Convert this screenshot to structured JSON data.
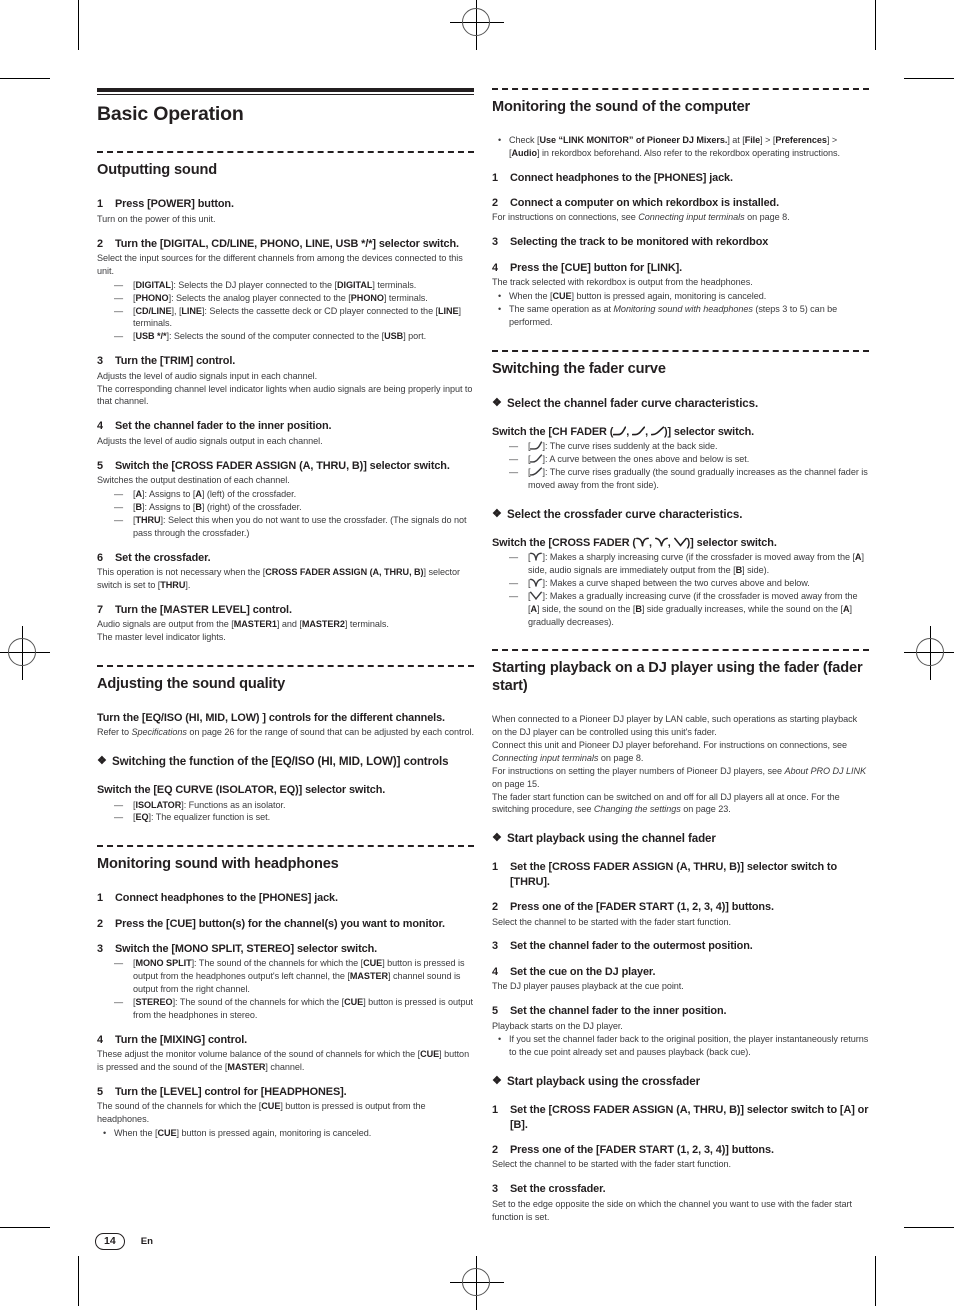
{
  "document": {
    "title": "Basic Operation",
    "footer": {
      "page_number": "14",
      "language": "En"
    }
  },
  "left_column": {
    "s1": {
      "heading": "Outputting sound",
      "step1": {
        "num": "1",
        "title": "Press [POWER] button.",
        "body": "Turn on the power of this unit."
      },
      "step2": {
        "num": "2",
        "title": "Turn the [DIGITAL, CD/LINE, PHONO, LINE, USB */*] selector switch.",
        "body": "Select the input sources for the different channels from among the devices connected to this unit.",
        "items": [
          "[DIGITAL]: Selects the DJ player connected to the [DIGITAL] terminals.",
          "[PHONO]: Selects the analog player connected to the [PHONO] terminals.",
          "[CD/LINE], [LINE]: Selects the cassette deck or CD player connected to the [LINE] terminals.",
          "[USB */*]: Selects the sound of the computer connected to the [USB] port."
        ]
      },
      "step3": {
        "num": "3",
        "title": "Turn the [TRIM] control.",
        "body1": "Adjusts the level of audio signals input in each channel.",
        "body2": "The corresponding channel level indicator lights when audio signals are being properly input to that channel."
      },
      "step4": {
        "num": "4",
        "title": "Set the channel fader to the inner position.",
        "body": "Adjusts the level of audio signals output in each channel."
      },
      "step5": {
        "num": "5",
        "title": "Switch the [CROSS FADER ASSIGN (A, THRU, B)] selector switch.",
        "body": "Switches the output destination of each channel.",
        "items": [
          "[A]: Assigns to [A] (left) of the crossfader.",
          "[B]: Assigns to [B] (right) of the crossfader.",
          "[THRU]: Select this when you do not want to use the crossfader. (The signals do not pass through the crossfader.)"
        ]
      },
      "step6": {
        "num": "6",
        "title": "Set the crossfader.",
        "body": "This operation is not necessary when the [CROSS FADER ASSIGN (A, THRU, B)] selector switch is set to [THRU]."
      },
      "step7": {
        "num": "7",
        "title": "Turn the [MASTER LEVEL] control.",
        "body1": "Audio signals are output from the [MASTER1] and [MASTER2] terminals.",
        "body2": "The master level indicator lights."
      }
    },
    "s2": {
      "heading": "Adjusting the sound quality",
      "lead_title": "Turn the [EQ/ISO (HI, MID, LOW) ] controls for the different channels.",
      "lead_body": "Refer to Specifications on page 26 for the range of sound that can be adjusted by each control.",
      "sub_heading": "Switching the function of the [EQ/ISO (HI, MID, LOW)] controls",
      "switch_title": "Switch the [EQ CURVE (ISOLATOR, EQ)] selector switch.",
      "items": [
        "[ISOLATOR]: Functions as an isolator.",
        "[EQ]: The equalizer function is set."
      ]
    },
    "s3": {
      "heading": "Monitoring sound with headphones",
      "step1": {
        "num": "1",
        "title": "Connect headphones to the [PHONES] jack."
      },
      "step2": {
        "num": "2",
        "title": "Press the [CUE] button(s) for the channel(s) you want to monitor."
      },
      "step3": {
        "num": "3",
        "title": "Switch the [MONO SPLIT, STEREO] selector switch.",
        "items": [
          "[MONO SPLIT]: The sound of the channels for which the [CUE] button is pressed is output from the headphones output's left channel, the [MASTER] channel sound is output from the right channel.",
          "[STEREO]: The sound of the channels for which the [CUE] button is pressed is output from the headphones in stereo."
        ]
      },
      "step4": {
        "num": "4",
        "title": "Turn the [MIXING] control.",
        "body": "These adjust the monitor volume balance of the sound of channels for which the [CUE] button is pressed and the sound of the [MASTER] channel."
      },
      "step5": {
        "num": "5",
        "title": "Turn the [LEVEL] control for [HEADPHONES].",
        "body": "The sound of the channels for which the [CUE] button is pressed is output from the headphones.",
        "note": "When the [CUE] button is pressed again, monitoring is canceled."
      }
    }
  },
  "right_column": {
    "s1": {
      "heading": "Monitoring the sound of the computer",
      "note": "Check [Use “LINK MONITOR” of Pioneer DJ Mixers.] at [File] > [Preferences] > [Audio] in rekordbox beforehand. Also refer to the rekordbox operating instructions.",
      "step1": {
        "num": "1",
        "title": "Connect headphones to the [PHONES] jack."
      },
      "step2": {
        "num": "2",
        "title": "Connect a computer on which rekordbox is installed.",
        "body": "For instructions on connections, see Connecting input terminals on page 8."
      },
      "step3": {
        "num": "3",
        "title": "Selecting the track to be monitored with rekordbox"
      },
      "step4": {
        "num": "4",
        "title": "Press the [CUE] button for [LINK].",
        "body": "The track selected with rekordbox is output from the headphones.",
        "notes": [
          "When the [CUE] button is pressed again, monitoring is canceled.",
          "The same operation as at Monitoring sound with headphones (steps 3 to 5) can be performed."
        ]
      }
    },
    "s2": {
      "heading": "Switching the fader curve",
      "sub1": "Select the channel fader curve characteristics.",
      "ch_switch_title_a": "Switch the [CH FADER (",
      "ch_switch_title_b": ")] selector switch.",
      "ch_items": [
        "]: The curve rises suddenly at the back side.",
        "]: A curve between the ones above and below is set.",
        "]: The curve rises gradually (the sound gradually increases as the channel fader is moved away from the front side)."
      ],
      "sub2": "Select the crossfader curve characteristics.",
      "cf_switch_title_a": "Switch the [CROSS FADER (",
      "cf_switch_title_b": ")] selector switch.",
      "cf_items": [
        "]: Makes a sharply increasing curve (if the crossfader is moved away from the [A] side, audio signals are immediately output from the [B] side).",
        "]: Makes a curve shaped between the two curves above and below.",
        "]: Makes a gradually increasing curve (if the crossfader is moved away from the [A] side, the sound on the [B] side gradually increases, while the sound on the [A] gradually decreases)."
      ]
    },
    "s3": {
      "heading": "Starting playback on a DJ player using the fader (fader start)",
      "body1": "When connected to a Pioneer DJ player by LAN cable, such operations as starting playback on the DJ player can be controlled using this unit's fader.",
      "body2": "Connect this unit and Pioneer DJ player beforehand. For instructions on connections, see Connecting input terminals on page 8.",
      "body3": "For instructions on setting the player numbers of Pioneer DJ players, see About PRO DJ LINK on page 15.",
      "body4": "The fader start function can be switched on and off for all DJ players all at once. For the switching procedure, see Changing the settings on page 23.",
      "sub1": "Start playback using the channel fader",
      "cf_steps": {
        "step1": {
          "num": "1",
          "title": "Set the [CROSS FADER ASSIGN (A, THRU, B)] selector switch to [THRU]."
        },
        "step2": {
          "num": "2",
          "title": "Press one of the [FADER START (1, 2, 3, 4)] buttons.",
          "body": "Select the channel to be started with the fader start function."
        },
        "step3": {
          "num": "3",
          "title": "Set the channel fader to the outermost position."
        },
        "step4": {
          "num": "4",
          "title": "Set the cue on the DJ player.",
          "body": "The DJ player pauses playback at the cue point."
        },
        "step5": {
          "num": "5",
          "title": "Set the channel fader to the inner position.",
          "body": "Playback starts on the DJ player.",
          "note": "If you set the channel fader back to the original position, the player instantaneously returns to the cue point already set and pauses playback (back cue)."
        }
      },
      "sub2": "Start playback using the crossfader",
      "x_steps": {
        "step1": {
          "num": "1",
          "title": "Set the [CROSS FADER ASSIGN (A, THRU, B)] selector switch to [A] or [B]."
        },
        "step2": {
          "num": "2",
          "title": "Press one of the [FADER START (1, 2, 3, 4)] buttons.",
          "body": "Select the channel to be started with the fader start function."
        },
        "step3": {
          "num": "3",
          "title": "Set the crossfader.",
          "body": "Set to the edge opposite the side on which the channel you want to use with the fader start function is set."
        }
      }
    }
  },
  "marks": {
    "diamond": "❖",
    "dash": "—",
    "bullet": "•"
  }
}
